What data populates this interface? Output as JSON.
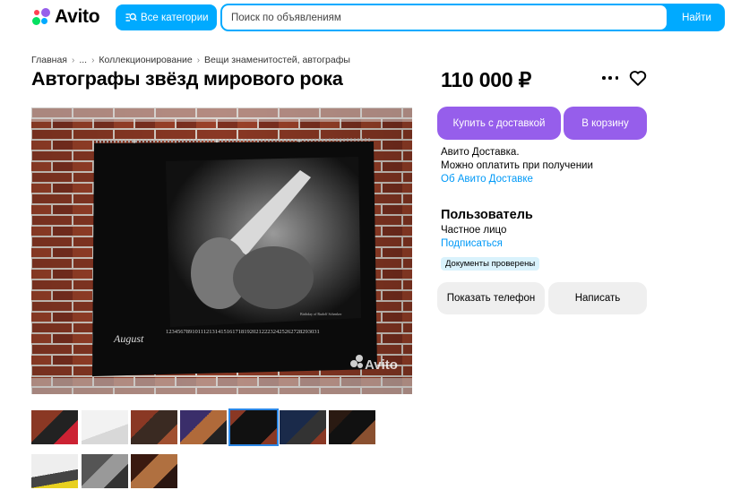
{
  "header": {
    "logo_text": "Avito",
    "categories_button": "Все категории",
    "search_placeholder": "Поиск по объявлениям",
    "search_button": "Найти",
    "brand_colors": {
      "blue": "#00AAFF",
      "green": "#04E061",
      "red": "#FF4053",
      "purple": "#965EEB"
    }
  },
  "breadcrumb": [
    "Главная",
    "...",
    "Коллекционирование",
    "Вещи знаменитостей, автографы"
  ],
  "listing": {
    "title": "Автографы звёзд мирового рока",
    "price": "110 000 ₽",
    "image_calendar_month": "August",
    "image_calendar_days": "12345678910111213141516171819202122232425262728293031",
    "image_caption": "Birthday of Rudolf Schenker",
    "image_watermark": "Avito",
    "thumbnail_count": 10
  },
  "actions": {
    "buy_with_delivery": "Купить с доставкой",
    "add_to_cart": "В корзину",
    "more_icon": "more-horizontal-icon",
    "favorite_icon": "heart-icon"
  },
  "delivery": {
    "line1": "Авито Доставка.",
    "line2": "Можно оплатить при получении",
    "link": "Об Авито Доставке"
  },
  "seller": {
    "name": "Пользователь",
    "type": "Частное лицо",
    "subscribe": "Подписаться",
    "badge": "Документы проверены"
  },
  "contact": {
    "show_phone": "Показать телефон",
    "write": "Написать"
  }
}
